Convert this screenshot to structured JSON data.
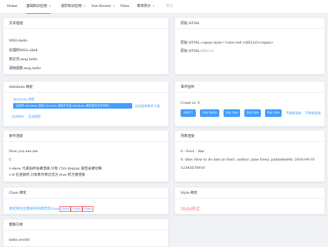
{
  "menu": {
    "items": [
      {
        "label": "Home"
      },
      {
        "label": "基础知识应用"
      },
      {
        "label": "进阶知识应用"
      },
      {
        "label": "Vue-Router"
      },
      {
        "label": "Pinia"
      },
      {
        "label": "菜单例子"
      },
      {
        "label": "菜单"
      }
    ]
  },
  "text_interp": {
    "title": "文本插值",
    "lines": [
      "MSG:hello",
      "处理的MSG:olleh",
      "表达式:msg hello",
      "调用函数:msg hello"
    ]
  },
  "raw_html": {
    "title": "原始 HTML",
    "line1": "原始 HTML:<span style='color:red'>HELLO</span>",
    "line2_prefix": "原始 HTML:",
    "line2_red": "HELLO"
  },
  "attribute": {
    "title": "Attribute 绑定",
    "tooltip_small": "Attribute 绑定",
    "tooltip_bar": "动态的 Attribute 是由 Vue/Vite 接收并生成 Attribute 属性值为空字符串:(",
    "link1": "启动禁用原手下值",
    "link2": "启动布尔",
    "link3": "启动绑定"
  },
  "events": {
    "title": "事件监听",
    "count": "Count is: 0",
    "buttons": [
      "Add 1",
      "Say hello",
      "Say bye",
      "Say bye",
      "Say bye"
    ],
    "link1": "不刷新链接",
    "link2": "不刷新链接"
  },
  "conditional": {
    "title": "条件渲染",
    "line1": "Now you see me",
    "line2": "C",
    "line3": "v-show 元素始终会被渲染,只有 CSS display 属性会被切换",
    "line4": "v-if 在渲染时,只有条件表达式为 true 时才被渲染"
  },
  "list": {
    "title": "列表渲染",
    "line1": "0 - Foo1 - Bar",
    "line2": "0. title: How to do lists in Vue1; author: Jane Doe2; publishedAt: 2016-04-10",
    "line3": "12345678910"
  },
  "class_binding": {
    "title": "Class 绑定",
    "text": "绑定将在在数组中的类样式class",
    "boxes": [
      "class",
      "class",
      "class"
    ]
  },
  "style_binding": {
    "title": "Style 绑定",
    "text": "Style样式"
  },
  "template_ref": {
    "title": "模板引用",
    "text": "hello,world!"
  },
  "colors": {
    "primary": "#409eff",
    "danger": "#f56c6c",
    "background": "#f0f2f5"
  }
}
